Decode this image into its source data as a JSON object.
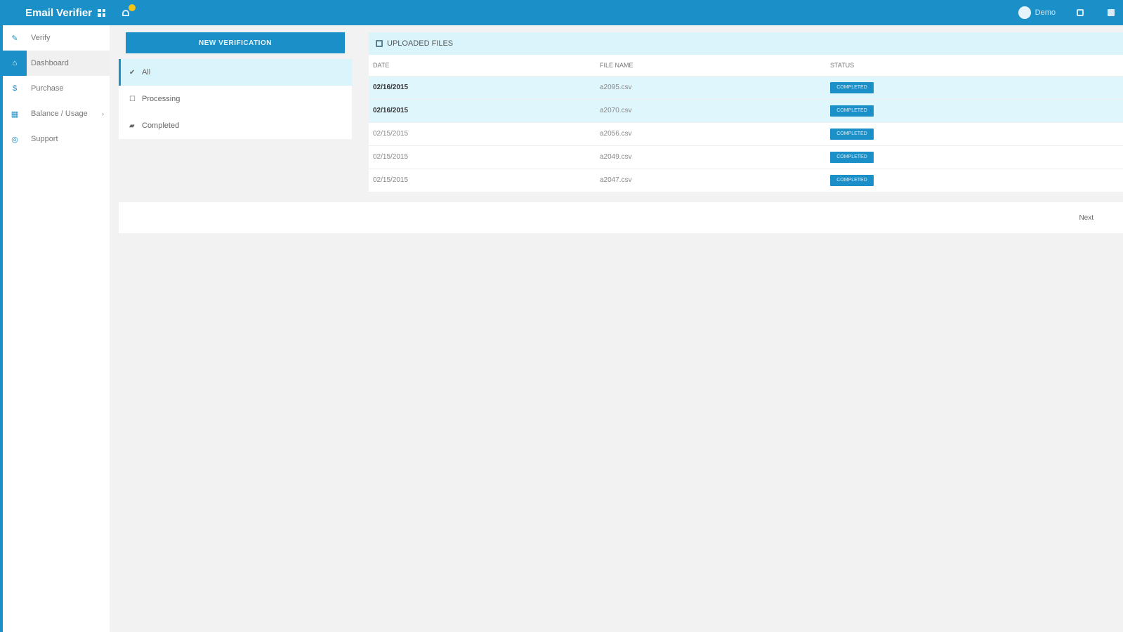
{
  "app": {
    "title": "Email Verifier"
  },
  "header": {
    "username": "Demo"
  },
  "sidebar": {
    "items": [
      {
        "label": "Verify",
        "icon": "pencil-icon",
        "glyph": "✎"
      },
      {
        "label": "Dashboard",
        "icon": "home-icon",
        "glyph": "⌂"
      },
      {
        "label": "Purchase",
        "icon": "dollar-icon",
        "glyph": "$"
      },
      {
        "label": "Balance / Usage",
        "icon": "grid-icon",
        "glyph": "▦"
      },
      {
        "label": "Support",
        "icon": "lifebuoy-icon",
        "glyph": "◎"
      }
    ]
  },
  "filters": {
    "new_button": "NEW VERIFICATION",
    "items": [
      {
        "label": "All",
        "icon": "check-icon",
        "glyph": "✔"
      },
      {
        "label": "Processing",
        "icon": "checkbox-icon",
        "glyph": "☐"
      },
      {
        "label": "Completed",
        "icon": "stack-icon",
        "glyph": "▰"
      }
    ]
  },
  "files": {
    "title": "UPLOADED FILES",
    "columns": [
      "DATE",
      "FILE NAME",
      "STATUS"
    ],
    "rows": [
      {
        "date": "02/16/2015",
        "file": "a2095.csv",
        "status": "COMPLETED"
      },
      {
        "date": "02/16/2015",
        "file": "a2070.csv",
        "status": "COMPLETED"
      },
      {
        "date": "02/15/2015",
        "file": "a2056.csv",
        "status": "COMPLETED"
      },
      {
        "date": "02/15/2015",
        "file": "a2049.csv",
        "status": "COMPLETED"
      },
      {
        "date": "02/15/2015",
        "file": "a2047.csv",
        "status": "COMPLETED"
      }
    ]
  },
  "pagination": {
    "next_label": "Next"
  },
  "colors": {
    "accent": "#1a8fc8",
    "highlight": "#d9f4fb",
    "notification": "#f0c419"
  }
}
